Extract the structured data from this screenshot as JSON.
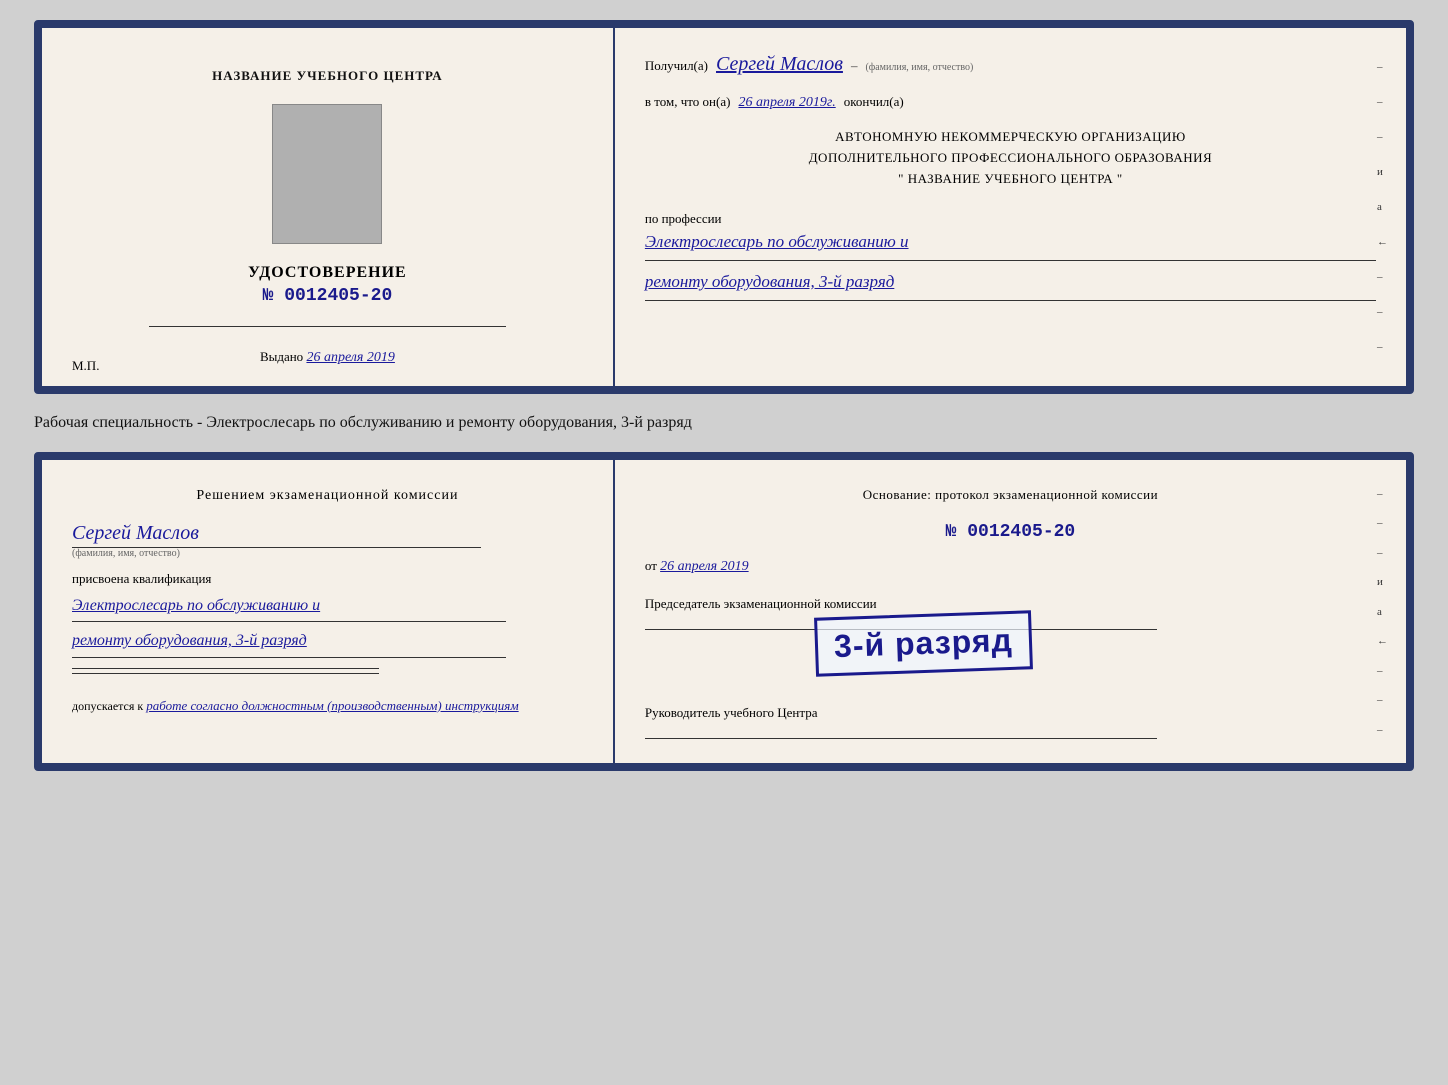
{
  "page": {
    "background": "#d0d0d0"
  },
  "top_card": {
    "left": {
      "center_title": "НАЗВАНИЕ УЧЕБНОГО ЦЕНТРА",
      "cert_title": "УДОСТОВЕРЕНИЕ",
      "cert_number_prefix": "№",
      "cert_number": "0012405-20",
      "issued_label": "Выдано",
      "issued_date": "26 апреля 2019",
      "mp_label": "М.П."
    },
    "right": {
      "received_label": "Получил(а)",
      "recipient_name": "Сергей Маслов",
      "name_sublabel": "(фамилия, имя, отчество)",
      "date_prefix": "в том, что он(а)",
      "date_value": "26 апреля 2019г.",
      "finished_label": "окончил(а)",
      "org_line1": "АВТОНОМНУЮ НЕКОММЕРЧЕСКУЮ ОРГАНИЗАЦИЮ",
      "org_line2": "ДОПОЛНИТЕЛЬНОГО ПРОФЕССИОНАЛЬНОГО ОБРАЗОВАНИЯ",
      "org_line3": "\"  НАЗВАНИЕ УЧЕБНОГО ЦЕНТРА  \"",
      "profession_label": "по профессии",
      "profession_line1": "Электрослесарь по обслуживанию и",
      "profession_line2": "ремонту оборудования, 3-й разряд"
    }
  },
  "between_label": "Рабочая специальность - Электрослесарь по обслуживанию и ремонту оборудования, 3-й разряд",
  "bottom_card": {
    "left": {
      "decision_title": "Решением экзаменационной комиссии",
      "person_name": "Сергей Маслов",
      "name_sublabel": "(фамилия, имя, отчество)",
      "qualification_label": "присвоена квалификация",
      "qualification_line1": "Электрослесарь по обслуживанию и",
      "qualification_line2": "ремонту оборудования, 3-й разряд",
      "admitted_label": "допускается к",
      "admitted_text": "работе согласно должностным (производственным) инструкциям"
    },
    "right": {
      "basis_label": "Основание: протокол экзаменационной комиссии",
      "protocol_prefix": "№",
      "protocol_number": "0012405-20",
      "date_prefix": "от",
      "date_value": "26 апреля 2019",
      "chairman_label": "Председатель экзаменационной комиссии",
      "stamp_text": "3-й разряд",
      "rukovoditel_label": "Руководитель учебного Центра"
    }
  },
  "side_marks": [
    "–",
    "–",
    "–",
    "и",
    "а",
    "←",
    "–",
    "–",
    "–"
  ]
}
